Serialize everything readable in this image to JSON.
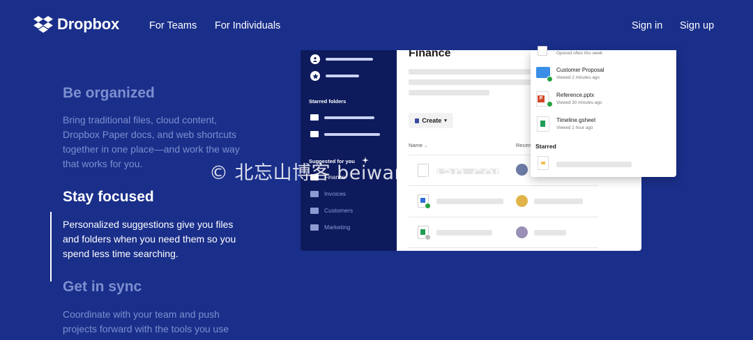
{
  "header": {
    "brand": "Dropbox",
    "nav": [
      "For Teams",
      "For Individuals"
    ],
    "sign_in": "Sign in",
    "sign_up": "Sign up"
  },
  "features": [
    {
      "title": "Be organized",
      "body": "Bring traditional files, cloud content, Dropbox Paper docs, and web shortcuts together in one place—and work the way that works for you."
    },
    {
      "title": "Stay focused",
      "body": "Personalized suggestions give you files and folders when you need them so you spend less time searching."
    },
    {
      "title": "Get in sync",
      "body": "Coordinate with your team and push projects forward with the tools you use"
    }
  ],
  "app": {
    "sidebar": {
      "starred_label": "Starred folders",
      "suggested_label": "Suggested for you",
      "suggested_items": [
        "Finance",
        "Invoices",
        "Customers",
        "Marketing"
      ]
    },
    "main": {
      "title": "Finance",
      "create_label": "Create",
      "col_name": "Name",
      "col_recent": "Recen"
    },
    "popup": {
      "top_sub": "Opened often this week",
      "files": [
        {
          "name": "Customer Proposal",
          "sub": "Viewed 2 minutes ago"
        },
        {
          "name": "Reference.pptx",
          "sub": "Viewed 30 minutes ago"
        },
        {
          "name": "Timeline.gsheet",
          "sub": "Viewed 1 hour ago"
        }
      ],
      "starred_heading": "Starred"
    }
  },
  "watermark": "© 北忘山博客 beiwangshan.com",
  "colors": {
    "background": "#1a2f8a",
    "sidebar": "#0d1a5c",
    "dim_text": "#7d8fd0",
    "accent_folder": "#3a8ee6"
  }
}
